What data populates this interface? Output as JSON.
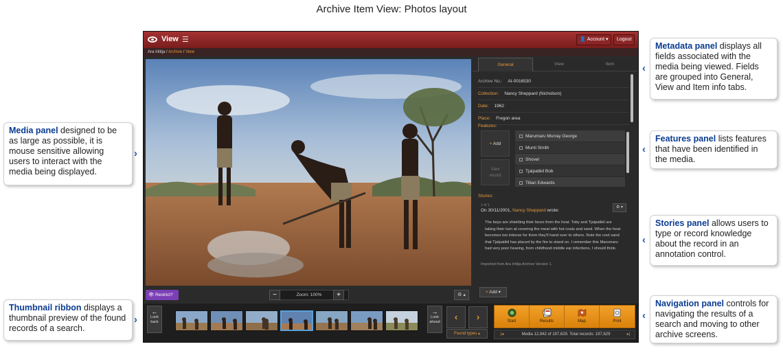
{
  "diagram": {
    "title": "Archive Item View: Photos layout"
  },
  "callouts": {
    "media": {
      "heading": "Media panel",
      "text": " designed to be as large as possible, it is mouse sensitive allowing users to interact with the media being displayed."
    },
    "thumbnail": {
      "heading": "Thumbnail ribbon",
      "text": " displays a thumbnail preview of the found records of a search."
    },
    "metadata": {
      "heading": "Metadata panel",
      "text": " displays all fields associated with the media being viewed. Fields are grouped into General, View and Item info tabs."
    },
    "features": {
      "heading": "Features panel",
      "text": " lists features that have been identified in the  media."
    },
    "stories": {
      "heading": "Stories panel",
      "text": " allows users to type or record knowledge about the record in an annotation control."
    },
    "navigation": {
      "heading": "Navigation panel",
      "text": " controls for navigating the results of a search and moving to other archive screens."
    }
  },
  "app": {
    "title": "View",
    "account_label": "Account",
    "logout_label": "Logout",
    "breadcrumb": {
      "home": "Ara Irititja",
      "sep": "/",
      "archive": "Archive",
      "current": "View"
    },
    "colors": {
      "header": "#8c2626",
      "accent": "#e49a3c",
      "restrict": "#7b3fb5",
      "nav": "#f2a029"
    }
  },
  "media_toolbar": {
    "restrict_label": "Restrict?",
    "zoom_minus": "−",
    "zoom_label": "Zoom: 100%",
    "zoom_plus": "+",
    "gear_label": "⚙ ▴"
  },
  "metadata": {
    "tabs": [
      "General",
      "View",
      "Item"
    ],
    "rows": [
      {
        "label": "Archive No.:",
        "value": "AI-0016530"
      },
      {
        "label": "Collection:",
        "value": "Nancy Sheppard (Nicholson)"
      },
      {
        "label": "Date:",
        "value": "1962"
      },
      {
        "label": "Place:",
        "value": "Fregon area"
      }
    ]
  },
  "features": {
    "label": "Features:",
    "add_label": "Add",
    "view_line1": "View",
    "view_line2": "record",
    "items": [
      "Marumaru Murray George",
      "Munti Smith",
      "Shovel",
      "Tjalpatikil Bob",
      "Tiltari Edwards"
    ]
  },
  "stories": {
    "label": "Stories:",
    "count": "1 of 1",
    "date_prefix": "On 30/11/2001, ",
    "author": "Nancy Sheppard",
    "wrote": " wrote:",
    "text": "The boys are shielding their faces from the heat. Toby and Tjalpatikil are taking their turn at covering the meat with hot coals and sand. When the heat becomes too intense for them they'll hand over to others. Note the cool sand that Tjalpatikil has placed by the fire to stand on. I remember this Marumaru had very poor hearing, from childhood middle ear infections, I should think.",
    "import_note": "Imported from Ara Irititja Archive Version 1.",
    "add_label": "Add",
    "gear_label": "⚙ ▾"
  },
  "thumbnails": {
    "look_back_1": "Look",
    "look_back_2": "back",
    "look_ahead_1": "Look",
    "look_ahead_2": "ahead",
    "count": 7,
    "active_index": 3
  },
  "navigation": {
    "prev": "‹",
    "next": "›",
    "found_types": "Found types ▴",
    "buttons": [
      "Start",
      "Results",
      "Map",
      "Print"
    ],
    "first": "|◂",
    "last": "▸|",
    "status": "Media 12,942 of 197,629. Total records: 197,629"
  }
}
